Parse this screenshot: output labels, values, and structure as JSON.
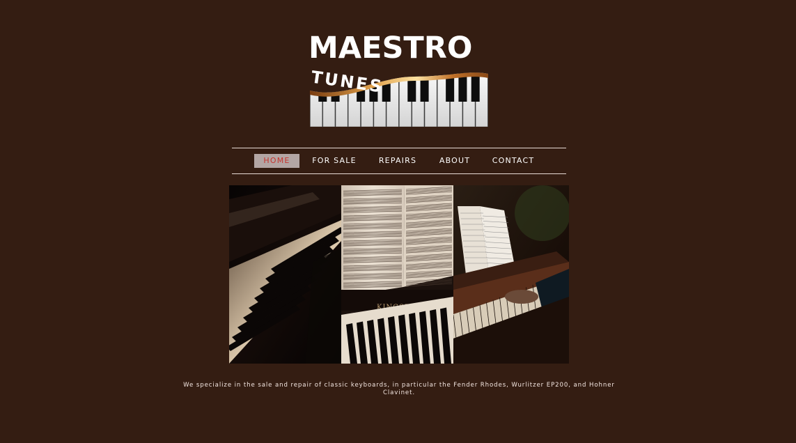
{
  "brand": {
    "title": "MAESTRO",
    "subtitle": "TUNES"
  },
  "nav": {
    "items": [
      {
        "label": "HOME",
        "active": true
      },
      {
        "label": "FOR SALE",
        "active": false
      },
      {
        "label": "REPAIRS",
        "active": false
      },
      {
        "label": "ABOUT",
        "active": false
      },
      {
        "label": "CONTACT",
        "active": false
      }
    ]
  },
  "hero": {
    "panels": [
      "piano-keys-closeup",
      "sheet-music-on-piano",
      "hands-playing-upright-piano"
    ],
    "piano_brand": "KINGSBUR"
  },
  "tagline": "We specialize in the sale and repair of classic keyboards, in particular the Fender Rhodes, Wurlitzer EP200, and Hohner Clavinet.",
  "colors": {
    "background": "#341d12",
    "nav_active_bg": "#b3a6a4",
    "nav_active_text": "#c6352f",
    "text": "#ffffff"
  }
}
